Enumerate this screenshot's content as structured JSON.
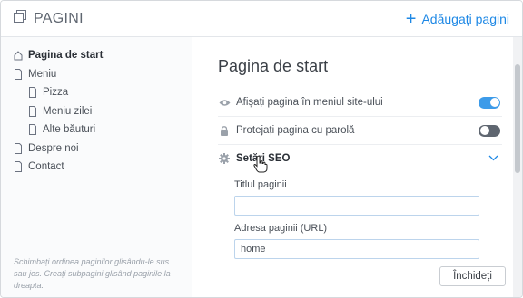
{
  "header": {
    "title": "PAGINI",
    "add_label": "Adăugați pagini"
  },
  "sidebar": {
    "items": [
      {
        "label": "Pagina de start",
        "level": 0,
        "icon": "home-icon",
        "active": true
      },
      {
        "label": "Meniu",
        "level": 0,
        "icon": "page-icon"
      },
      {
        "label": "Pizza",
        "level": 1,
        "icon": "page-icon"
      },
      {
        "label": "Meniu zilei",
        "level": 1,
        "icon": "page-icon"
      },
      {
        "label": "Alte băuturi",
        "level": 1,
        "icon": "page-icon"
      },
      {
        "label": "Despre noi",
        "level": 0,
        "icon": "page-icon"
      },
      {
        "label": "Contact",
        "level": 0,
        "icon": "page-icon"
      }
    ],
    "hint": "Schimbați ordinea paginilor glisându-le sus sau jos. Creați subpagini glisând paginile la dreapta."
  },
  "main": {
    "title": "Pagina de start",
    "show_in_menu": {
      "label": "Afișați pagina în meniul site-ului",
      "on": true
    },
    "password": {
      "label": "Protejați pagina cu parolă",
      "on": false
    },
    "seo": {
      "label": "Setări SEO"
    },
    "page_title_field": {
      "label": "Titlul paginii",
      "value": ""
    },
    "page_url_field": {
      "label": "Adresa paginii (URL)",
      "value": "home"
    },
    "close_label": "Închideți"
  },
  "colors": {
    "accent": "#1e88e5",
    "toggle_on": "#3d9be9",
    "toggle_off": "#5f6670"
  }
}
